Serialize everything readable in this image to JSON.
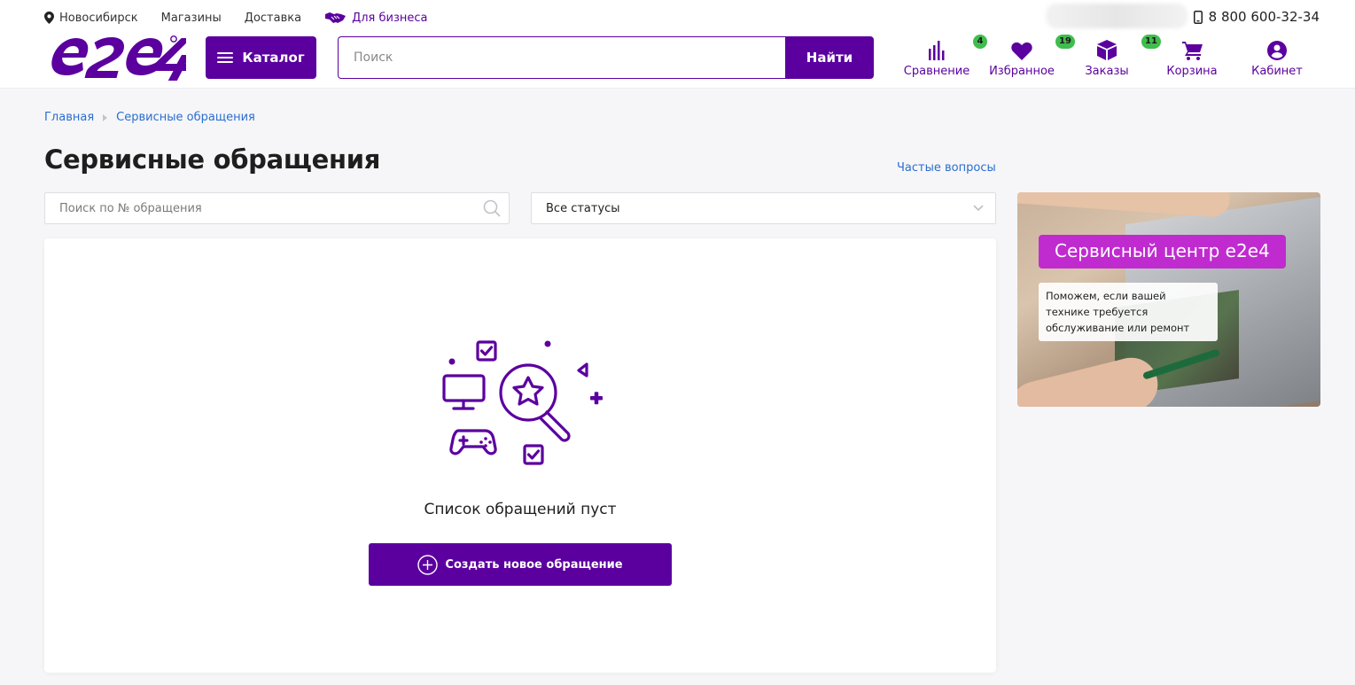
{
  "topbar": {
    "city": "Новосибирск",
    "stores": "Магазины",
    "delivery": "Доставка",
    "business": "Для бизнеса",
    "phone": "8 800 600-32-34"
  },
  "header": {
    "catalog_label": "Каталог",
    "search_placeholder": "Поиск",
    "search_button": "Найти",
    "nav": {
      "compare": {
        "label": "Сравнение",
        "badge": "4"
      },
      "favorites": {
        "label": "Избранное",
        "badge": "19"
      },
      "orders": {
        "label": "Заказы",
        "badge": "11"
      },
      "cart": {
        "label": "Корзина"
      },
      "account": {
        "label": "Кабинет"
      }
    }
  },
  "breadcrumb": {
    "home": "Главная",
    "current": "Сервисные обращения"
  },
  "page": {
    "title": "Сервисные обращения",
    "faq_link": "Частые вопросы",
    "search_placeholder": "Поиск по № обращения",
    "status_select": "Все статусы",
    "empty_text": "Список обращений пуст",
    "create_button": "Создать новое обращение"
  },
  "banner": {
    "title": "Сервисный центр e2e4",
    "subtitle": "Поможем, если вашей технике требуется обслуживание или ремонт"
  },
  "colors": {
    "brand": "#5b009f",
    "badge": "#3fbd4d",
    "link": "#2a6ecf",
    "banner_accent": "#c02bd0"
  },
  "icons": [
    "location-icon",
    "handshake-icon",
    "phone-icon",
    "menu-icon",
    "compare-icon",
    "heart-icon",
    "box-icon",
    "cart-icon",
    "user-icon",
    "search-icon",
    "chevron-down-icon",
    "plus-circle-icon"
  ]
}
